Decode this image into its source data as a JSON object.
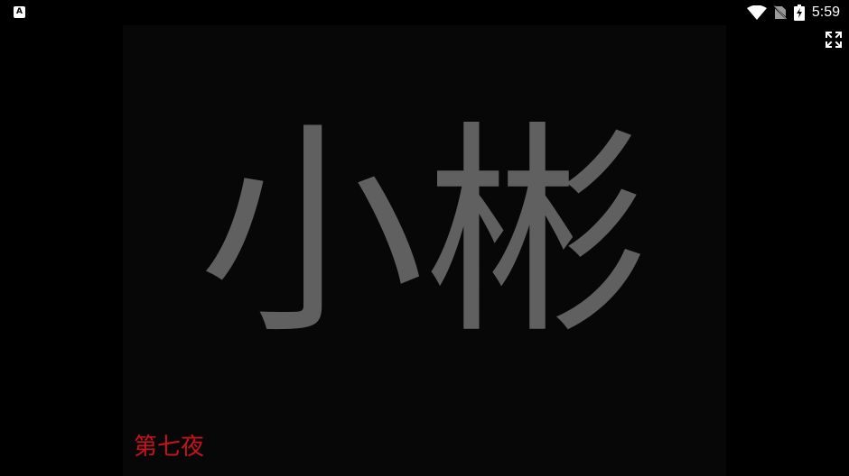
{
  "status_bar": {
    "notification_icon": "app-notification-icon",
    "notification_glyph": "A",
    "wifi_icon": "wifi-icon",
    "sim_icon": "no-sim-icon",
    "battery_icon": "battery-charging-icon",
    "time": "5:59"
  },
  "toolbar": {
    "fullscreen_icon": "fullscreen-expand-icon"
  },
  "game": {
    "title": "小彬",
    "chapter": "第七夜"
  },
  "colors": {
    "background": "#000000",
    "panel": "#070707",
    "title_text": "#606060",
    "chapter_text": "#c4141c"
  }
}
